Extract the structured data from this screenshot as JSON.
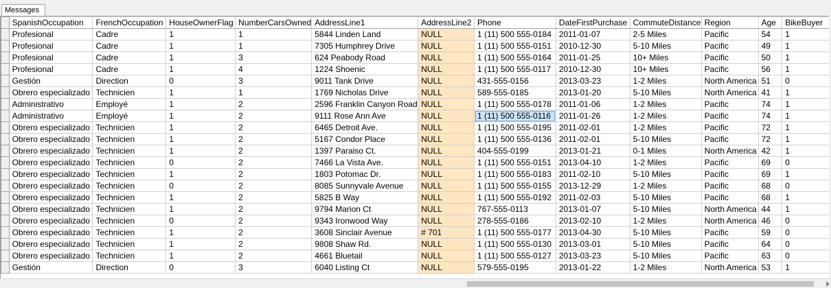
{
  "tabs": [
    {
      "label": "Messages"
    }
  ],
  "columns": [
    "SpanishOccupation",
    "FrenchOccupation",
    "HouseOwnerFlag",
    "NumberCarsOwned",
    "AddressLine1",
    "AddressLine2",
    "Phone",
    "DateFirstPurchase",
    "CommuteDistance",
    "Region",
    "Age",
    "BikeBuyer"
  ],
  "rows": [
    [
      "Profesional",
      "Cadre",
      "1",
      "1",
      "5844 Linden Land",
      "NULL",
      "1 (11) 500 555-0184",
      "2011-01-07",
      "2-5 Miles",
      "Pacific",
      "54",
      "1"
    ],
    [
      "Profesional",
      "Cadre",
      "1",
      "1",
      "7305 Humphrey Drive",
      "NULL",
      "1 (11) 500 555-0151",
      "2010-12-30",
      "5-10 Miles",
      "Pacific",
      "49",
      "1"
    ],
    [
      "Profesional",
      "Cadre",
      "1",
      "3",
      "624 Peabody Road",
      "NULL",
      "1 (11) 500 555-0164",
      "2011-01-25",
      "10+ Miles",
      "Pacific",
      "50",
      "1"
    ],
    [
      "Profesional",
      "Cadre",
      "1",
      "4",
      "1224 Shoenic",
      "NULL",
      "1 (11) 500 555-0117",
      "2010-12-30",
      "10+ Miles",
      "Pacific",
      "56",
      "1"
    ],
    [
      "Gestión",
      "Direction",
      "0",
      "3",
      "9011 Tank Drive",
      "NULL",
      "431-555-0156",
      "2013-03-23",
      "1-2 Miles",
      "North America",
      "51",
      "0"
    ],
    [
      "Obrero especializado",
      "Technicien",
      "1",
      "1",
      "1769 Nicholas Drive",
      "NULL",
      "589-555-0185",
      "2013-01-20",
      "5-10 Miles",
      "North America",
      "41",
      "1"
    ],
    [
      "Administrativo",
      "Employé",
      "1",
      "2",
      "2596 Franklin Canyon Road",
      "NULL",
      "1 (11) 500 555-0178",
      "2011-01-06",
      "1-2 Miles",
      "Pacific",
      "74",
      "1"
    ],
    [
      "Administrativo",
      "Employé",
      "1",
      "2",
      "9111 Rose Ann Ave",
      "NULL",
      "1 (11) 500 555-0116",
      "2011-01-26",
      "1-2 Miles",
      "Pacific",
      "74",
      "1"
    ],
    [
      "Obrero especializado",
      "Technicien",
      "1",
      "2",
      "6465 Detroit Ave.",
      "NULL",
      "1 (11) 500 555-0195",
      "2011-02-01",
      "1-2 Miles",
      "Pacific",
      "72",
      "1"
    ],
    [
      "Obrero especializado",
      "Technicien",
      "1",
      "2",
      "5167 Condor Place",
      "NULL",
      "1 (11) 500 555-0136",
      "2011-02-01",
      "5-10 Miles",
      "Pacific",
      "72",
      "1"
    ],
    [
      "Obrero especializado",
      "Technicien",
      "1",
      "2",
      "1397 Paraiso Ct.",
      "NULL",
      "404-555-0199",
      "2013-01-21",
      "0-1 Miles",
      "North America",
      "42",
      "1"
    ],
    [
      "Obrero especializado",
      "Technicien",
      "0",
      "2",
      "7466 La Vista Ave.",
      "NULL",
      "1 (11) 500 555-0151",
      "2013-04-10",
      "1-2 Miles",
      "Pacific",
      "69",
      "0"
    ],
    [
      "Obrero especializado",
      "Technicien",
      "1",
      "2",
      "1803 Potomac Dr.",
      "NULL",
      "1 (11) 500 555-0183",
      "2011-02-10",
      "5-10 Miles",
      "Pacific",
      "69",
      "1"
    ],
    [
      "Obrero especializado",
      "Technicien",
      "0",
      "2",
      "8085 Sunnyvale Avenue",
      "NULL",
      "1 (11) 500 555-0155",
      "2013-12-29",
      "1-2 Miles",
      "Pacific",
      "68",
      "0"
    ],
    [
      "Obrero especializado",
      "Technicien",
      "1",
      "2",
      "5825 B Way",
      "NULL",
      "1 (11) 500 555-0192",
      "2011-02-03",
      "5-10 Miles",
      "Pacific",
      "68",
      "1"
    ],
    [
      "Obrero especializado",
      "Technicien",
      "1",
      "2",
      "9794 Marion Ct",
      "NULL",
      "767-555-0113",
      "2013-01-07",
      "5-10 Miles",
      "North America",
      "44",
      "1"
    ],
    [
      "Obrero especializado",
      "Technicien",
      "0",
      "2",
      "9343 Ironwood Way",
      "NULL",
      "278-555-0186",
      "2013-02-10",
      "1-2 Miles",
      "North America",
      "46",
      "0"
    ],
    [
      "Obrero especializado",
      "Technicien",
      "1",
      "2",
      "3608 Sinclair Avenue",
      "# 701",
      "1 (11) 500 555-0177",
      "2013-04-30",
      "5-10 Miles",
      "Pacific",
      "59",
      "0"
    ],
    [
      "Obrero especializado",
      "Technicien",
      "1",
      "2",
      "9808 Shaw Rd.",
      "NULL",
      "1 (11) 500 555-0130",
      "2013-03-01",
      "5-10 Miles",
      "Pacific",
      "64",
      "0"
    ],
    [
      "Obrero especializado",
      "Technicien",
      "1",
      "2",
      "4661 Bluetail",
      "NULL",
      "1 (11) 500 555-0127",
      "2013-03-23",
      "5-10 Miles",
      "Pacific",
      "63",
      "0"
    ],
    [
      "Gestión",
      "Direction",
      "0",
      "3",
      "6040 Listing Ct",
      "NULL",
      "579-555-0195",
      "2013-01-22",
      "1-2 Miles",
      "North America",
      "53",
      "1"
    ]
  ],
  "selected": {
    "row": 7,
    "col": 6
  },
  "colors": {
    "null_bg": "#fde6c0",
    "selected_bg": "#cce4f7"
  }
}
